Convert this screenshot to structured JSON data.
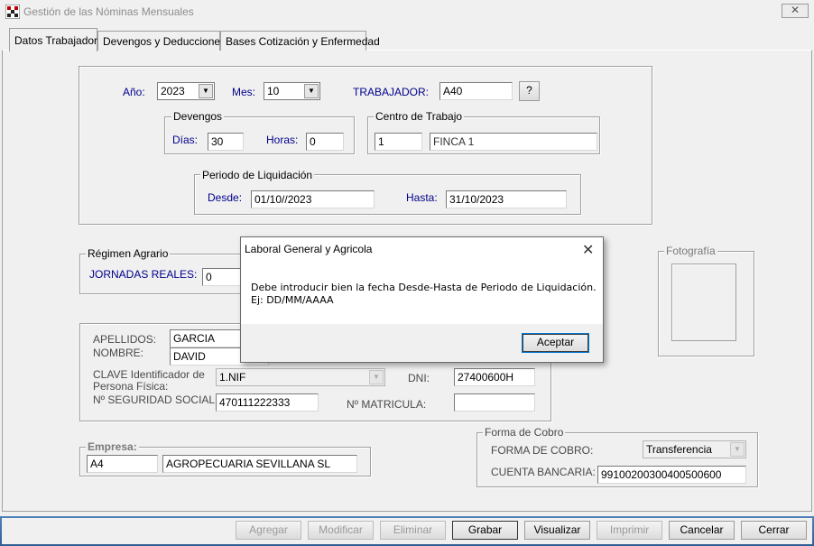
{
  "window": {
    "title": "Gestión de las Nóminas Mensuales",
    "close_label": "✕"
  },
  "tabs": [
    {
      "label": "Datos Trabajador"
    },
    {
      "label": "Devengos y Deducciones"
    },
    {
      "label": "Bases Cotización y Enfermedad"
    }
  ],
  "header": {
    "year_label": "Año:",
    "year_value": "2023",
    "month_label": "Mes:",
    "month_value": "10",
    "worker_label": "TRABAJADOR:",
    "worker_value": "A40",
    "lookup_label": "?"
  },
  "devengos": {
    "legend": "Devengos",
    "days_label": "Días:",
    "days_value": "30",
    "hours_label": "Horas:",
    "hours_value": "0"
  },
  "centro": {
    "legend": "Centro de Trabajo",
    "code": "1",
    "name": "FINCA 1"
  },
  "periodo": {
    "legend": "Periodo de Liquidación",
    "from_label": "Desde:",
    "from_value": "01/10//2023",
    "to_label": "Hasta:",
    "to_value": "31/10/2023"
  },
  "regimen": {
    "legend": "Régimen Agrario",
    "jornadas_label": "JORNADAS REALES:",
    "jornadas_value": "0"
  },
  "photo": {
    "legend": "Fotografía"
  },
  "person": {
    "surname_label": "APELLIDOS:",
    "surname_value": "GARCIA",
    "name_label": "NOMBRE:",
    "name_value": "DAVID",
    "id_type_label_1": "CLAVE Identificador de",
    "id_type_label_2": "Persona Física:",
    "id_type_value": "1.NIF",
    "dni_label": "DNI:",
    "dni_value": "27400600H",
    "ss_label": "Nº SEGURIDAD SOCIAL:",
    "ss_value": "470111222333",
    "matricula_label": "Nº MATRICULA:",
    "matricula_value": ""
  },
  "empresa": {
    "legend": "Empresa:",
    "code": "A4",
    "name": "AGROPECUARIA SEVILLANA SL"
  },
  "cobro": {
    "legend": "Forma de Cobro",
    "method_label": "FORMA DE COBRO:",
    "method_value": "Transferencia",
    "account_label": "CUENTA BANCARIA:",
    "account_value": "99100200300400500600"
  },
  "footer_buttons": [
    {
      "label": "Agregar"
    },
    {
      "label": "Modificar"
    },
    {
      "label": "Eliminar"
    },
    {
      "label": "Grabar"
    },
    {
      "label": "Visualizar"
    },
    {
      "label": "Imprimir"
    },
    {
      "label": "Cancelar"
    },
    {
      "label": "Cerrar"
    }
  ],
  "dialog": {
    "title": "Laboral General y Agricola",
    "close_label": "✕",
    "message": "Debe introducir bien la fecha Desde-Hasta de Periodo de Liquidación.\nEj: DD/MM/AAAA",
    "ok_label": "Aceptar"
  },
  "colors": {
    "label_blue": "#00008b",
    "footer_blue": "#3a6ea5",
    "disabled_text": "#9a9a9a"
  }
}
